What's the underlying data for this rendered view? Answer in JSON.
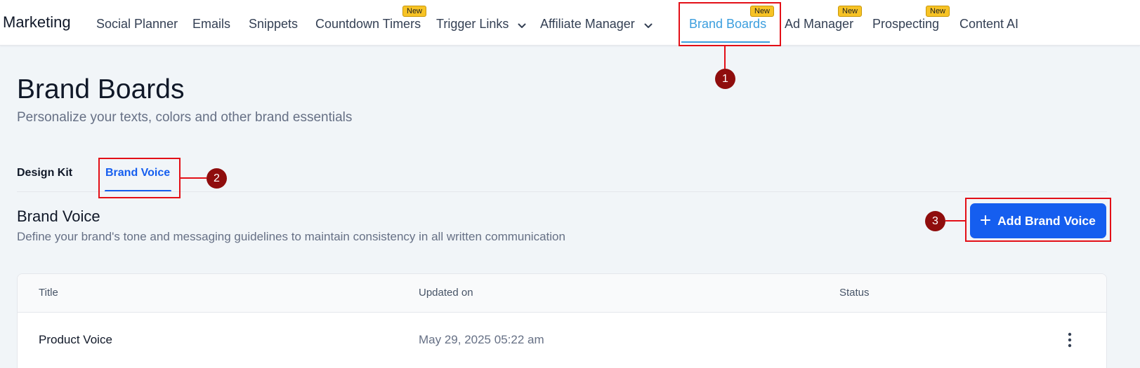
{
  "app": {
    "title": "Marketing"
  },
  "nav": {
    "items": [
      {
        "label": "Social Planner"
      },
      {
        "label": "Emails"
      },
      {
        "label": "Snippets"
      },
      {
        "label": "Countdown Timers",
        "badge": "New"
      },
      {
        "label": "Trigger Links",
        "icon": "chevron-down-icon"
      },
      {
        "label": "Affiliate Manager",
        "icon": "chevron-down-icon"
      },
      {
        "label": "Brand Boards",
        "badge": "New",
        "active": true
      },
      {
        "label": "Ad Manager",
        "badge": "New"
      },
      {
        "label": "Prospecting",
        "badge": "New"
      },
      {
        "label": "Content AI"
      }
    ]
  },
  "annotations": {
    "step1": "1",
    "step2": "2",
    "step3": "3",
    "color": "#e30f17",
    "marker_color": "#8f0d0d"
  },
  "page": {
    "title": "Brand Boards",
    "subtitle": "Personalize your texts, colors and other brand essentials"
  },
  "tabs": [
    {
      "label": "Design Kit"
    },
    {
      "label": "Brand Voice",
      "active": true
    }
  ],
  "section": {
    "title": "Brand Voice",
    "description": "Define your brand's tone and messaging guidelines to maintain consistency in all written communication",
    "add_button": "Add Brand Voice",
    "add_icon": "plus-icon"
  },
  "table": {
    "columns": [
      "Title",
      "Updated on",
      "Status"
    ],
    "rows": [
      {
        "title": "Product Voice",
        "updated_on": "May 29, 2025 05:22 am",
        "status": "",
        "actions_icon": "more-vertical-icon"
      }
    ]
  },
  "colors": {
    "accent": "#155eef",
    "nav_active": "#3b9ede",
    "badge": "#f7c325"
  }
}
